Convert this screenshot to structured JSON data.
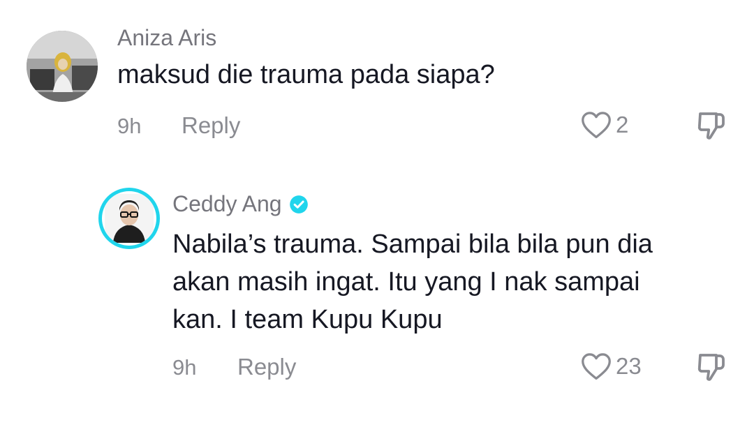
{
  "comments": [
    {
      "username": "Aniza Aris",
      "text": "maksud die trauma pada siapa?",
      "time": "9h",
      "reply_label": "Reply",
      "likes": "2",
      "avatar": "profile-photo"
    },
    {
      "username": "Ceddy Ang",
      "verified": true,
      "text_lines": [
        "Nabila’s trauma. Sampai bila bila pun dia",
        "akan masih ingat. Itu yang I nak sampai",
        "kan. I team Kupu Kupu"
      ],
      "time": "9h",
      "reply_label": "Reply",
      "likes": "23",
      "avatar": "profile-photo"
    }
  ],
  "icons": {
    "like": "heart-outline-icon",
    "dislike": "thumbs-down-outline-icon",
    "verified": "verified-badge-icon"
  },
  "colors": {
    "verified": "#20d5ec",
    "meta": "#8a8b91",
    "text": "#161823"
  }
}
